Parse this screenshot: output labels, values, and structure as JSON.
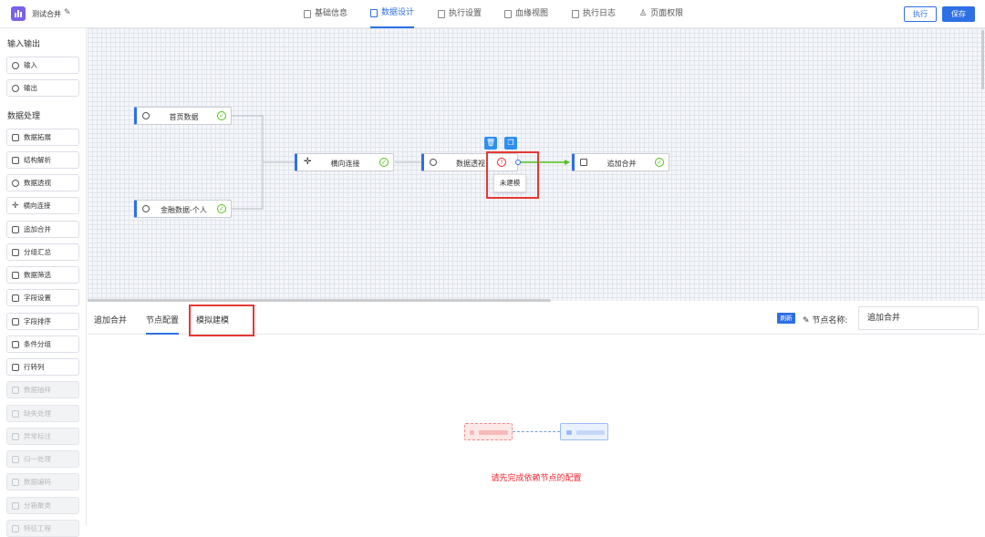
{
  "header": {
    "app_title": "测试合并",
    "tabs": [
      "基础信息",
      "数据设计",
      "执行设置",
      "血缘视图",
      "执行日志",
      "页面权限"
    ],
    "active_tab": "数据设计",
    "run_label": "执行",
    "save_label": "保存",
    "accent_color": "#2f6fe6"
  },
  "sidebar": {
    "io_title": "输入输出",
    "io_items": [
      "输入",
      "输出"
    ],
    "processing_title": "数据处理",
    "processing_items": [
      "数据拓展",
      "结构解析",
      "数据透视",
      "横向连接",
      "追加合并",
      "分组汇总",
      "数据筛选",
      "字段设置",
      "字段排序",
      "条件分组",
      "行转列"
    ],
    "disabled_items": [
      "数据抽样",
      "缺失处理",
      "异常标注",
      "归一处理",
      "数据编码",
      "分箱聚类",
      "特征工程"
    ]
  },
  "canvas": {
    "nodes": {
      "home_data": "首页数据",
      "finance_data": "金融数据-个人",
      "horizontal_join": "横向连接",
      "data_pivot": "数据透视",
      "append_merge": "追加合并"
    },
    "tooltip": "未建模"
  },
  "bottom": {
    "tabs": [
      "追加合并",
      "节点配置",
      "模拟建模"
    ],
    "active_tab": "节点配置",
    "refresh_label": "刷新",
    "node_name_label": "节点名称:",
    "node_name_value": "追加合并",
    "hint": "请先完成依赖节点的配置"
  }
}
